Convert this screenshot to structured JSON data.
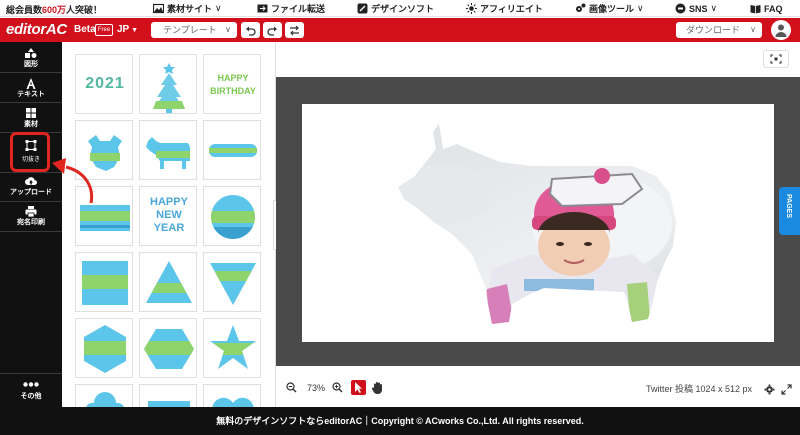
{
  "topbar": {
    "promo_prefix": "総会員数",
    "promo_highlight": "600万",
    "promo_suffix": "人突破！",
    "nav": [
      {
        "label": "素材サイト",
        "icon": "image-icon",
        "caret": "∨"
      },
      {
        "label": "ファイル転送",
        "icon": "file-transfer-icon",
        "caret": ""
      },
      {
        "label": "デザインソフト",
        "icon": "brush-icon",
        "caret": ""
      },
      {
        "label": "アフィリエイト",
        "icon": "sun-icon",
        "caret": ""
      },
      {
        "label": "画像ツール",
        "icon": "gear-icon",
        "caret": "∨"
      },
      {
        "label": "SNS",
        "icon": "chat-icon",
        "caret": "∨"
      },
      {
        "label": "FAQ",
        "icon": "book-icon",
        "caret": ""
      }
    ]
  },
  "header": {
    "logo": "editorAC",
    "beta": "Beta",
    "free_badge": "Free",
    "language": "JP",
    "template_button": "テンプレート",
    "download_button": "ダウンロード",
    "header_color": "#d1101c"
  },
  "sidebar": {
    "items": [
      {
        "label": "図形",
        "icon": "shapes-icon"
      },
      {
        "label": "テキスト",
        "icon": "text-icon"
      },
      {
        "label": "素材",
        "icon": "grid-icon"
      },
      {
        "label": "切抜き",
        "icon": "crop-icon"
      },
      {
        "label": "アップロード",
        "icon": "cloud-upload-icon"
      },
      {
        "label": "宛名印刷",
        "icon": "printer-icon"
      }
    ],
    "other_label": "その他",
    "other_icon": "more-dots-icon"
  },
  "assets": {
    "tiles": [
      {
        "kind": "text",
        "text": "2021"
      },
      {
        "kind": "tree"
      },
      {
        "kind": "text",
        "text": "HAPPY BIRTHDAY"
      },
      {
        "kind": "ox"
      },
      {
        "kind": "ox-side"
      },
      {
        "kind": "rounded-bar"
      },
      {
        "kind": "landscape-rect"
      },
      {
        "kind": "text",
        "text": "HAPPY NEW YEAR"
      },
      {
        "kind": "circle"
      },
      {
        "kind": "square"
      },
      {
        "kind": "triangle-up"
      },
      {
        "kind": "triangle-down"
      },
      {
        "kind": "hexagon"
      },
      {
        "kind": "hexagon-wide"
      },
      {
        "kind": "star"
      },
      {
        "kind": "cloud"
      },
      {
        "kind": "rect"
      },
      {
        "kind": "heart"
      }
    ]
  },
  "editor": {
    "zoom": "73%",
    "size_info": "Twitter 投稿 1024 x 512 px",
    "pages_tab": "PAGES"
  },
  "footer": {
    "text": "無料のデザインソフトならeditorAC｜Copyright © ACworks Co.,Ltd. All rights reserved."
  }
}
